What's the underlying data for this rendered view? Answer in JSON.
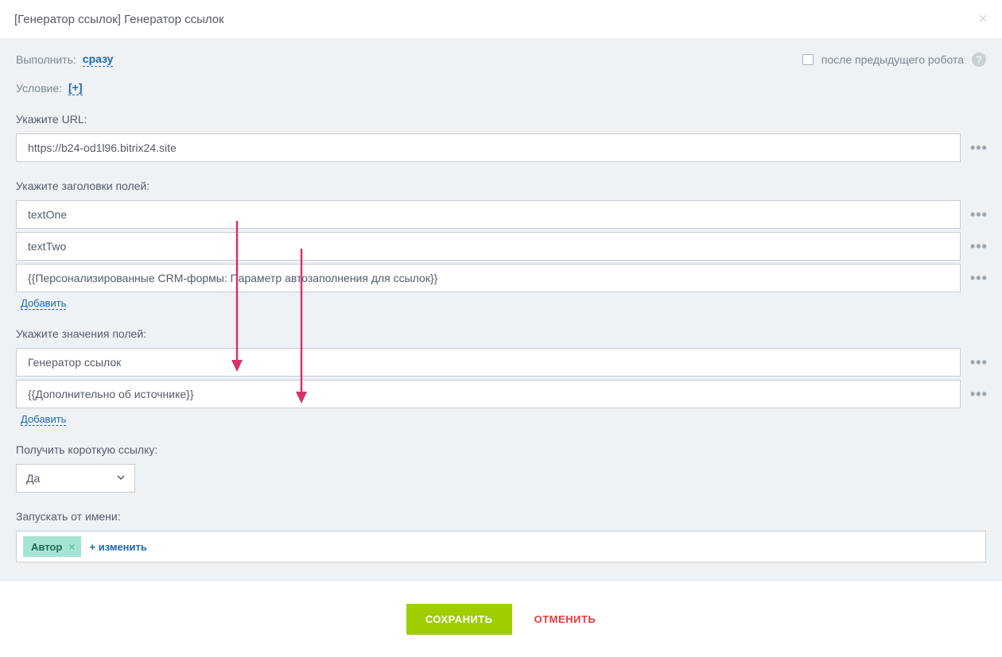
{
  "header": {
    "title": "[Генератор ссылок] Генератор ссылок"
  },
  "execute": {
    "label": "Выполнить:",
    "value": "сразу",
    "after_prev_label": "после предыдущего робота"
  },
  "condition": {
    "label": "Условие:",
    "value": "[+]"
  },
  "url": {
    "label": "Укажите URL:",
    "value": "https://b24-od1l96.bitrix24.site"
  },
  "headers": {
    "label": "Укажите заголовки полей:",
    "items": [
      "textOne",
      "textTwo",
      "{{Персонализированные CRM-формы: Параметр автозаполнения для ссылок}}"
    ],
    "add": "Добавить"
  },
  "values": {
    "label": "Укажите значения полей:",
    "items": [
      "Генератор ссылок",
      "{{Дополнительно об источнике}}"
    ],
    "add": "Добавить"
  },
  "shortlink": {
    "label": "Получить короткую ссылку:",
    "selected": "Да"
  },
  "runas": {
    "label": "Запускать от имени:",
    "tag": "Автор",
    "change": "изменить"
  },
  "footer": {
    "save": "СОХРАНИТЬ",
    "cancel": "ОТМЕНИТЬ"
  },
  "colors": {
    "accent": "#9dcf00",
    "link": "#2067b0",
    "danger": "#e23c3c",
    "arrow": "#d6336c"
  }
}
